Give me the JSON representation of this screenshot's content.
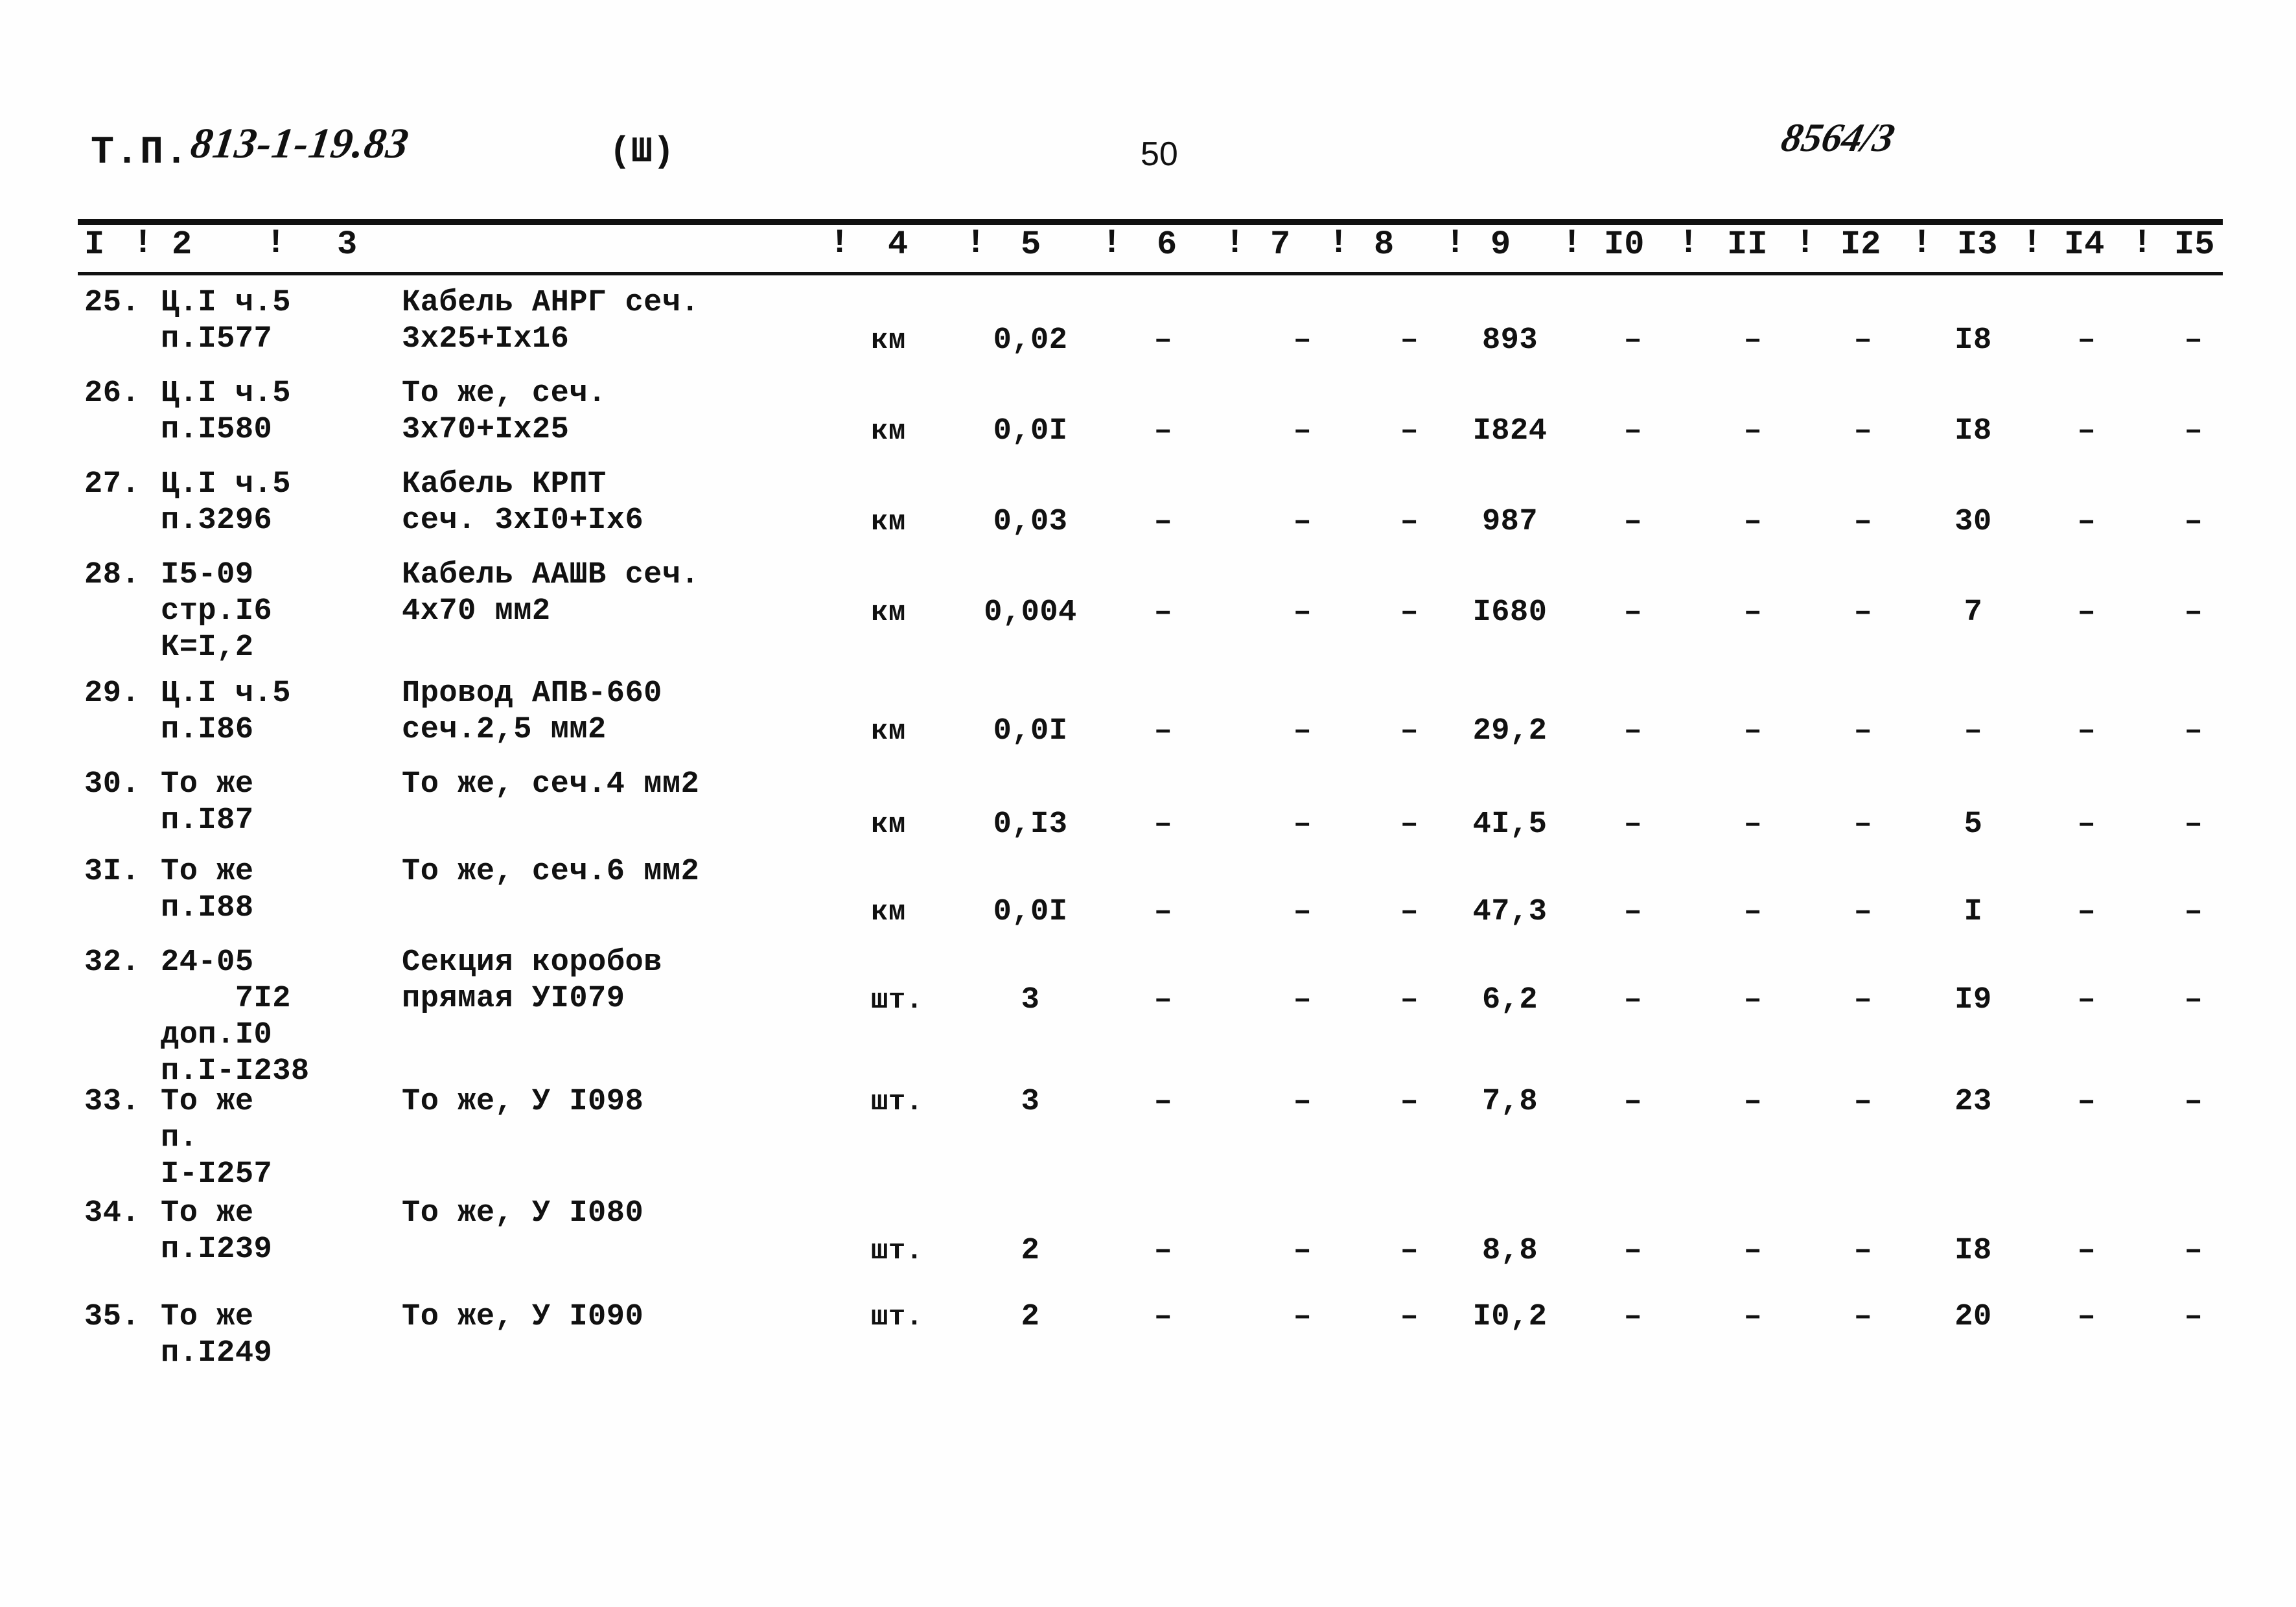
{
  "header": {
    "doc_prefix": "Т.П.",
    "doc_code": "813-1-19.83",
    "part": "(Ш)",
    "page_number": "50",
    "stamp": "8564/3"
  },
  "table": {
    "column_headers": [
      "I",
      "2",
      "3",
      "4",
      "5",
      "6",
      "7",
      "8",
      "9",
      "I0",
      "II",
      "I2",
      "I3",
      "I4",
      "I5"
    ],
    "separator": "!",
    "rows": [
      {
        "no": "25.",
        "ref": "Ц.I ч.5\nп.I577",
        "name": "Кабель АНРГ сеч.\n3х25+Iх16",
        "unit": "км",
        "c4": "0,02",
        "c5": "–",
        "c6": "–",
        "c7": "–",
        "c8": "893",
        "c9": "–",
        "c10": "–",
        "c11": "–",
        "c12": "I8",
        "c13": "–",
        "c14": "–"
      },
      {
        "no": "26.",
        "ref": "Ц.I ч.5\nп.I580",
        "name": "То же, сеч.\n3х70+Iх25",
        "unit": "км",
        "c4": "0,0I",
        "c5": "–",
        "c6": "–",
        "c7": "–",
        "c8": "I824",
        "c9": "–",
        "c10": "–",
        "c11": "–",
        "c12": "I8",
        "c13": "–",
        "c14": "–"
      },
      {
        "no": "27.",
        "ref": "Ц.I ч.5\nп.3296",
        "name": "Кабель КРПТ\nсеч. 3хI0+Iх6",
        "unit": "км",
        "c4": "0,03",
        "c5": "–",
        "c6": "–",
        "c7": "–",
        "c8": "987",
        "c9": "–",
        "c10": "–",
        "c11": "–",
        "c12": "30",
        "c13": "–",
        "c14": "–"
      },
      {
        "no": "28.",
        "ref": "I5-09\nстр.I6\nК=I,2",
        "name": "Кабель ААШВ сеч.\n4х70 мм2",
        "unit": "км",
        "c4": "0,004",
        "c5": "–",
        "c6": "–",
        "c7": "–",
        "c8": "I680",
        "c9": "–",
        "c10": "–",
        "c11": "–",
        "c12": "7",
        "c13": "–",
        "c14": "–"
      },
      {
        "no": "29.",
        "ref": "Ц.I ч.5\nп.I86",
        "name": "Провод АПВ-660\nсеч.2,5 мм2",
        "unit": "км",
        "c4": "0,0I",
        "c5": "–",
        "c6": "–",
        "c7": "–",
        "c8": "29,2",
        "c9": "–",
        "c10": "–",
        "c11": "–",
        "c12": "–",
        "c13": "–",
        "c14": "–"
      },
      {
        "no": "30.",
        "ref": "То же\nп.I87",
        "name": "То же, сеч.4 мм2",
        "unit": "км",
        "c4": "0,I3",
        "c5": "–",
        "c6": "–",
        "c7": "–",
        "c8": "4I,5",
        "c9": "–",
        "c10": "–",
        "c11": "–",
        "c12": "5",
        "c13": "–",
        "c14": "–"
      },
      {
        "no": "3I.",
        "ref": "То же\nп.I88",
        "name": "То же, сеч.6 мм2",
        "unit": "км",
        "c4": "0,0I",
        "c5": "–",
        "c6": "–",
        "c7": "–",
        "c8": "47,3",
        "c9": "–",
        "c10": "–",
        "c11": "–",
        "c12": "I",
        "c13": "–",
        "c14": "–"
      },
      {
        "no": "32.",
        "ref": "24-05\n    7I2\nдоп.I0\nп.I-I238",
        "name": "Секция коробов\nпрямая УI079",
        "unit": "шт.",
        "c4": "3",
        "c5": "–",
        "c6": "–",
        "c7": "–",
        "c8": "6,2",
        "c9": "–",
        "c10": "–",
        "c11": "–",
        "c12": "I9",
        "c13": "–",
        "c14": "–"
      },
      {
        "no": "33.",
        "ref": "То же\nп.\nI-I257",
        "name": "То же, У I098",
        "unit": "шт.",
        "c4": "3",
        "c5": "–",
        "c6": "–",
        "c7": "–",
        "c8": "7,8",
        "c9": "–",
        "c10": "–",
        "c11": "–",
        "c12": "23",
        "c13": "–",
        "c14": "–"
      },
      {
        "no": "34.",
        "ref": "То же\nп.I239",
        "name": "То же, У I080",
        "unit": "шт.",
        "c4": "2",
        "c5": "–",
        "c6": "–",
        "c7": "–",
        "c8": "8,8",
        "c9": "–",
        "c10": "–",
        "c11": "–",
        "c12": "I8",
        "c13": "–",
        "c14": "–"
      },
      {
        "no": "35.",
        "ref": "То же\nп.I249",
        "name": "То же, У I090",
        "unit": "шт.",
        "c4": "2",
        "c5": "–",
        "c6": "–",
        "c7": "–",
        "c8": "I0,2",
        "c9": "–",
        "c10": "–",
        "c11": "–",
        "c12": "20",
        "c13": "–",
        "c14": "–"
      }
    ]
  }
}
